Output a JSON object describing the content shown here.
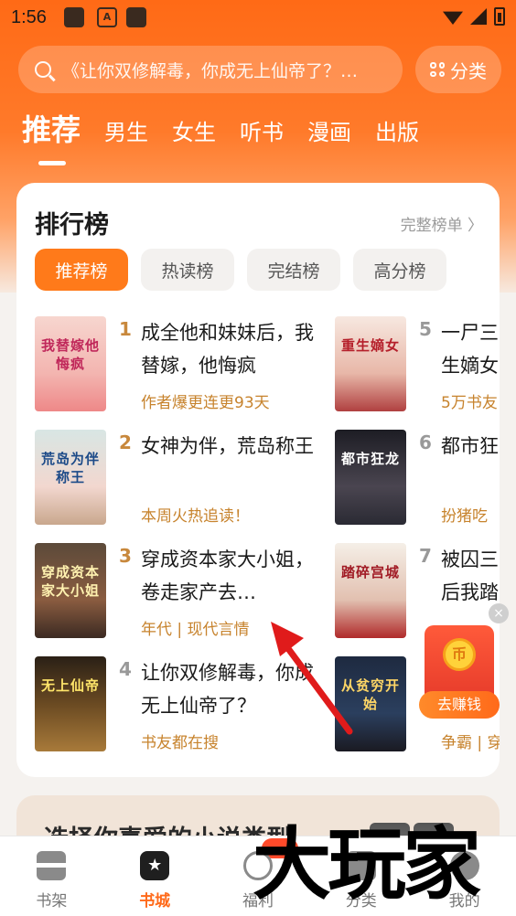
{
  "status_bar": {
    "time": "1:56",
    "notif_a_label": "A"
  },
  "search": {
    "placeholder": "《让你双修解毒，你成无上仙帝了？…"
  },
  "category_button": {
    "label": "分类"
  },
  "top_tabs": [
    {
      "label": "推荐",
      "active": true
    },
    {
      "label": "男生"
    },
    {
      "label": "女生"
    },
    {
      "label": "听书"
    },
    {
      "label": "漫画"
    },
    {
      "label": "出版"
    }
  ],
  "ranking": {
    "title": "排行榜",
    "more": "完整榜单 〉",
    "pills": [
      "推荐榜",
      "热读榜",
      "完结榜",
      "高分榜"
    ],
    "left_books": [
      {
        "rank": "1",
        "title": "成全他和妹妹后，我替嫁，他悔疯",
        "sub": "作者爆更连更93天",
        "cover_text": "我替嫁他悔疯"
      },
      {
        "rank": "2",
        "title": "女神为伴，荒岛称王",
        "sub": "本周火热追读！",
        "cover_text": "荒岛为伴称王"
      },
      {
        "rank": "3",
        "title": "穿成资本家大小姐，卷走家产去…",
        "sub": "年代 | 现代言情",
        "cover_text": "穿成资本家大小姐"
      },
      {
        "rank": "4",
        "title": "让你双修解毒，你成无上仙帝了？",
        "sub": "书友都在搜",
        "cover_text": "无上仙帝"
      }
    ],
    "right_books": [
      {
        "rank": "5",
        "title": "一尸三",
        "title2": "生嫡女",
        "sub": "5万书友",
        "cover_text": "重生嫡女"
      },
      {
        "rank": "6",
        "title": "都市狂",
        "sub": "扮猪吃",
        "cover_text": "都市狂龙"
      },
      {
        "rank": "7",
        "title": "被囚三",
        "title2": "后我踏",
        "sub": "",
        "cover_text": "踏碎宫城"
      },
      {
        "rank": "8",
        "title": "",
        "sub": "争霸 | 穿",
        "cover_text": "从贫穷开始"
      }
    ]
  },
  "promo": {
    "coin": "币",
    "button": "去赚钱",
    "close": "×"
  },
  "section2": {
    "title": "选择你喜爱的小说类型"
  },
  "bottom_nav": [
    {
      "label": "书架"
    },
    {
      "label": "书城",
      "active": true
    },
    {
      "label": "福利"
    },
    {
      "label": "分类"
    },
    {
      "label": "我的"
    }
  ],
  "watermark": {
    "text": "大玩家"
  }
}
